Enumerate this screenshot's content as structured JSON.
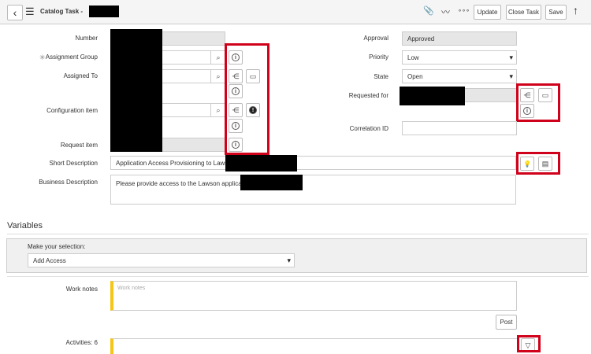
{
  "header": {
    "title": "Catalog Task -",
    "update_label": "Update",
    "close_task_label": "Close Task",
    "save_label": "Save"
  },
  "fields": {
    "number": {
      "label": "Number"
    },
    "assignment_group": {
      "label": "Assignment Group",
      "required_mark": "✳"
    },
    "assigned_to": {
      "label": "Assigned To"
    },
    "configuration_item": {
      "label": "Configuration item"
    },
    "request_item": {
      "label": "Request item"
    },
    "approval": {
      "label": "Approval",
      "value": "Approved"
    },
    "priority": {
      "label": "Priority",
      "value": "Low"
    },
    "state": {
      "label": "State",
      "value": "Open"
    },
    "requested_for": {
      "label": "Requested for"
    },
    "correlation_id": {
      "label": "Correlation ID"
    },
    "short_description": {
      "label": "Short Description",
      "value": "Application Access Provisioning to Lawson"
    },
    "business_description": {
      "label": "Business Description",
      "value": "Please provide access to the Lawson application"
    }
  },
  "variables": {
    "title": "Variables",
    "selection_label": "Make your selection:",
    "selection_value": "Add Access"
  },
  "work_notes": {
    "label": "Work notes",
    "placeholder": "Work notes",
    "post_label": "Post"
  },
  "activities": {
    "label": "Activities: 6"
  },
  "icons": {
    "back": "‹",
    "menu": "☰",
    "attach": "📎",
    "activity": "〰",
    "more": "∘∘∘",
    "up": "↑",
    "search": "⌕",
    "info": "i",
    "tree": "⋲",
    "card": "▭",
    "alert": "!",
    "bulb": "💡",
    "book": "▤",
    "filter": "▽"
  },
  "colors": {
    "highlight": "#d0021b",
    "required": "#f5c518",
    "work_notes_bar": "#f5c518"
  }
}
